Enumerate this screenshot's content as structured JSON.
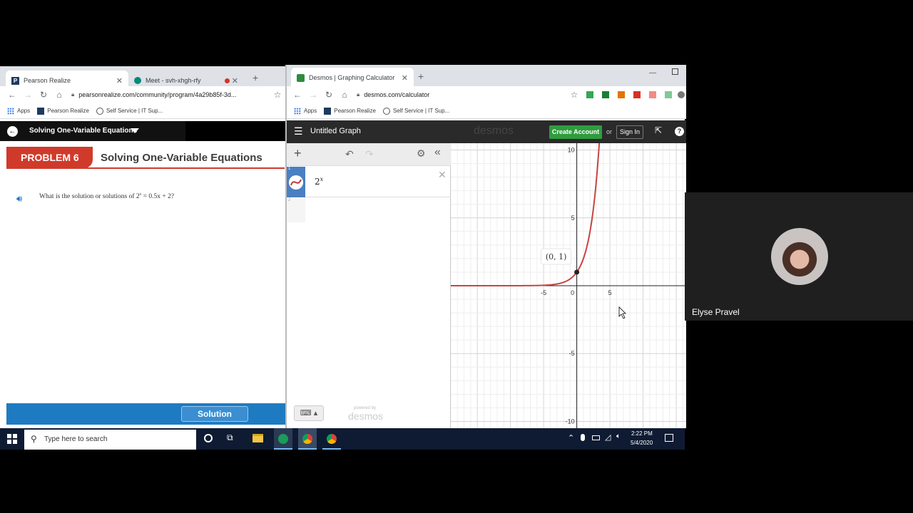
{
  "left_browser": {
    "tabs": [
      {
        "label": "Pearson Realize",
        "favicon": "P"
      },
      {
        "label": "Meet - svh-xhgh-rfy"
      }
    ],
    "url": "pearsonrealize.com/community/program/4a29b85f-3d...",
    "bookmarks": [
      "Apps",
      "Pearson Realize",
      "Self Service | IT Sup..."
    ],
    "header_title": "Solving One-Variable Equations",
    "problem_badge": "PROBLEM 6",
    "problem_title": "Solving One-Variable Equations",
    "question_text": "What is the solution or solutions of 2",
    "question_exp": "x",
    "question_rest": " = 0.5x + 2?",
    "solution_label": "Solution"
  },
  "right_browser": {
    "tab_label": "Desmos | Graphing Calculator",
    "url": "desmos.com/calculator",
    "bookmarks": [
      "Apps",
      "Pearson Realize",
      "Self Service | IT Sup..."
    ],
    "graph_title": "Untitled Graph",
    "logo": "desmos",
    "create_account": "Create Account",
    "or_text": "or",
    "sign_in": "Sign In",
    "expressions": [
      {
        "index": "1",
        "base": "2",
        "exp": "x"
      },
      {
        "index": "2"
      }
    ],
    "powered_by": "powered by",
    "footer_logo": "desmos",
    "point_label": "(0, 1)",
    "x_ticks": [
      "-5",
      "0",
      "5"
    ],
    "y_ticks": [
      "10",
      "5",
      "-5",
      "-10"
    ]
  },
  "taskbar": {
    "search_placeholder": "Type here to search",
    "time": "2:22 PM",
    "date": "5/4/2020"
  },
  "participant": {
    "name": "Elyse Pravel"
  },
  "chart_data": {
    "type": "line",
    "series": [
      {
        "name": "",
        "function": "2^x",
        "color": "#c74440"
      }
    ],
    "point": {
      "x": 0,
      "y": 1,
      "label": "(0, 1)"
    },
    "xlim": [
      -19,
      16.5
    ],
    "ylim": [
      -10.5,
      10.5
    ],
    "grid": true
  }
}
